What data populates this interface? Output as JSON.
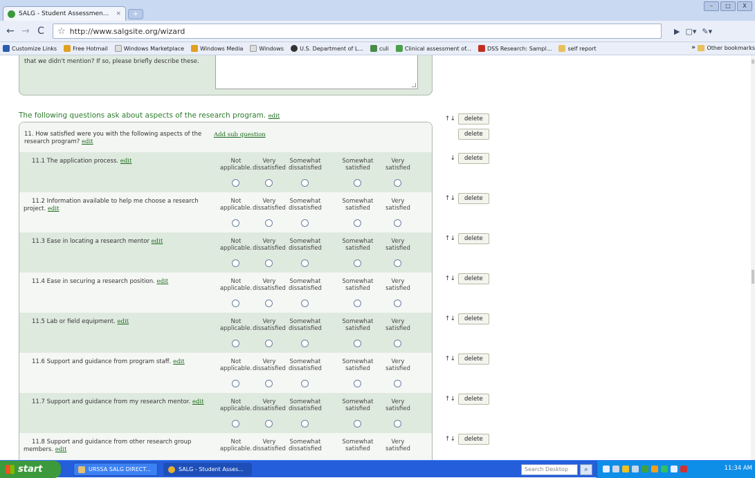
{
  "browser": {
    "tab_title": "SALG - Student Assessmen...",
    "tab_close": "×",
    "new_tab": "+",
    "url": "http://www.salgsite.org/wizard",
    "window_buttons": [
      "–",
      "□",
      "X"
    ]
  },
  "bookmarks": [
    {
      "label": "Customize Links",
      "color": "#2a5db0"
    },
    {
      "label": "Free Hotmail",
      "color": "#e0a020"
    },
    {
      "label": "Windows Marketplace",
      "color": "#cccccc"
    },
    {
      "label": "Windows Media",
      "color": "#e0a020"
    },
    {
      "label": "Windows",
      "color": "#cccccc"
    },
    {
      "label": "U.S. Department of L...",
      "color": "#333333"
    },
    {
      "label": "culi",
      "color": "#4a8a4a"
    },
    {
      "label": "Clinical assessment of...",
      "color": "#4aa04a"
    },
    {
      "label": "DSS Research: Sampl...",
      "color": "#c03020"
    },
    {
      "label": "self report",
      "color": "#e8c060"
    }
  ],
  "bookmarks_more": "»",
  "bookmarks_other": "Other bookmarks",
  "prev_question": {
    "text": "that we didn't mention? If so, please briefly describe these."
  },
  "section": {
    "header": "The following questions ask about aspects of the research program.",
    "edit": "edit"
  },
  "question": {
    "text": "11. How satisfied were you with the following aspects of the research program?",
    "edit": "edit",
    "add_sub": "Add sub question"
  },
  "options": [
    {
      "line1": "Not",
      "line2": "applicable."
    },
    {
      "line1": "Very",
      "line2": "dissatisfied"
    },
    {
      "line1": "Somewhat",
      "line2": "dissatisfied"
    },
    {
      "line1": "Somewhat",
      "line2": "satisfied"
    },
    {
      "line1": "Very",
      "line2": "satisfied"
    }
  ],
  "sub_questions": [
    {
      "text": "11.1 The application process.",
      "edit": "edit",
      "arrows": "↓"
    },
    {
      "text": "11.2 Information available to help me choose a research project.",
      "edit": "edit",
      "arrows": "↑↓"
    },
    {
      "text": "11.3 Ease in locating a research mentor",
      "edit": "edit",
      "arrows": "↑↓"
    },
    {
      "text": "11.4 Ease in securing a research position.",
      "edit": "edit",
      "arrows": "↑↓"
    },
    {
      "text": "11.5 Lab or field equipment.",
      "edit": "edit",
      "arrows": "↑↓"
    },
    {
      "text": "11.6 Support and guidance from program staff.",
      "edit": "edit",
      "arrows": "↑↓"
    },
    {
      "text": "11.7 Support and guidance from my research mentor.",
      "edit": "edit",
      "arrows": "↑↓"
    },
    {
      "text": "11.8 Support and guidance from other research group members.",
      "edit": "edit",
      "arrows": "↑↓"
    }
  ],
  "controls": {
    "section_arrows": "↑↓",
    "delete": "delete"
  },
  "taskbar": {
    "start": "start",
    "tasks": [
      "URSSA SALG DIRECT...",
      "SALG - Student Asses..."
    ],
    "search_placeholder": "Search Desktop",
    "clock": "11:34 AM"
  }
}
